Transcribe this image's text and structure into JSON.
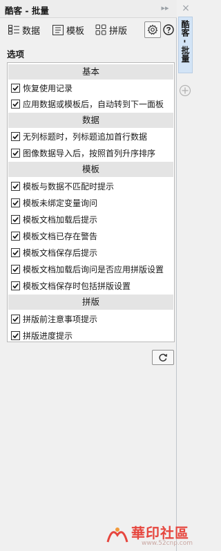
{
  "window": {
    "title": "酷客 - 批量"
  },
  "toolbar": {
    "data_label": "数据",
    "template_label": "模板",
    "imposition_label": "拼版"
  },
  "options_title": "选项",
  "groups": [
    {
      "header": "基本",
      "items": [
        {
          "label": "恢复使用记录",
          "checked": true
        },
        {
          "label": "应用数据或模板后，自动转到下一面板",
          "checked": true
        }
      ]
    },
    {
      "header": "数据",
      "items": [
        {
          "label": "无列标题时，列标题追加首行数据",
          "checked": true
        },
        {
          "label": "图像数据导入后，按照首列升序排序",
          "checked": true
        }
      ]
    },
    {
      "header": "模板",
      "items": [
        {
          "label": "模板与数据不匹配时提示",
          "checked": true
        },
        {
          "label": "模板未绑定变量询问",
          "checked": true
        },
        {
          "label": "模板文档加载后提示",
          "checked": true
        },
        {
          "label": "模板文档已存在警告",
          "checked": true
        },
        {
          "label": "模板文档保存后提示",
          "checked": true
        },
        {
          "label": "模板文档加载后询问是否应用拼版设置",
          "checked": true
        },
        {
          "label": "模板文档保存时包括拼版设置",
          "checked": true
        }
      ]
    },
    {
      "header": "拼版",
      "items": [
        {
          "label": "拼版前注意事项提示",
          "checked": true
        },
        {
          "label": "拼版进度提示",
          "checked": true
        }
      ]
    }
  ],
  "side_tab": {
    "label": "酷客 - 批量"
  },
  "watermark": {
    "text": "華印社區",
    "url": "www.52cnp.com"
  },
  "colors": {
    "background": "#f0f0f0",
    "header_bg": "#e4e4e4",
    "side_tab_bg": "#d3e4f6",
    "watermark": "#e6463e"
  },
  "icons": {
    "data": "data-grid-icon",
    "template": "template-icon",
    "imposition": "imposition-grid-icon",
    "settings": "gear-icon",
    "help": "help-icon",
    "refresh": "refresh-icon",
    "add": "add-circle-icon"
  }
}
